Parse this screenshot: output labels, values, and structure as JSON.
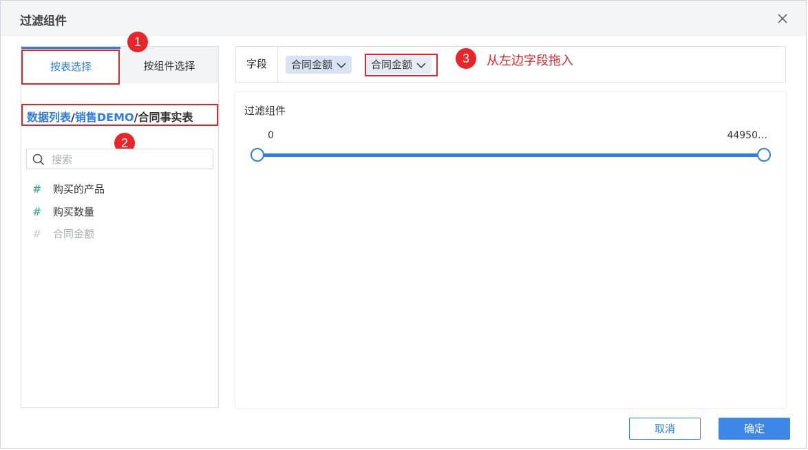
{
  "dialog": {
    "title": "过滤组件",
    "close_icon": "close-icon"
  },
  "left_panel": {
    "tabs": [
      {
        "label": "按表选择",
        "active": true
      },
      {
        "label": "按组件选择",
        "active": false
      }
    ],
    "breadcrumb": {
      "part1": "数据列表",
      "sep1": "/",
      "part2": "销售DEMO",
      "sep2": "/",
      "current": "合同事实表"
    },
    "search": {
      "placeholder": "搜索"
    },
    "fields": [
      {
        "hash": "#",
        "name": "购买的产品",
        "disabled": false
      },
      {
        "hash": "#",
        "name": "购买数量",
        "disabled": false
      },
      {
        "hash": "#",
        "name": "合同金额",
        "disabled": true
      }
    ]
  },
  "field_bar": {
    "label": "字段",
    "tags": [
      "合同金额",
      "合同金额"
    ]
  },
  "annotations": {
    "badge1": "1",
    "badge2": "2",
    "badge3": "3",
    "note": "从左边字段拖入"
  },
  "filter_area": {
    "title": "过滤组件",
    "range_min": "0",
    "range_max": "44950…",
    "slider": {
      "low_fraction": 0,
      "high_fraction": 1
    }
  },
  "footer": {
    "cancel_label": "取消",
    "ok_label": "确定"
  },
  "colors": {
    "accent": "#2f7de1",
    "annotation_red": "#e0262b",
    "field_hash": "#2ea58f"
  }
}
